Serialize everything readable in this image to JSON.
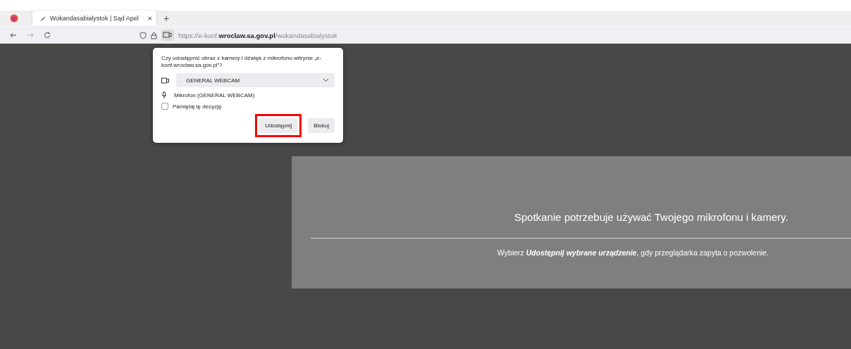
{
  "tabs": [
    {
      "title": "Wokandasabialystok | Sąd Apel",
      "selected": true,
      "close": "×"
    }
  ],
  "new_tab": "+",
  "address_bar": {
    "url": "https://e-konf.**wroclaw.sa.gov.pl**/wokandasabialystok"
  },
  "permission_popup": {
    "question": "Czy udostępnić obraz z kamery i dźwięk z mikrofonu witrynie „e-konf.wroclaw.sa.gov.pl”?",
    "camera": "GENERAL WEBCAM",
    "microphone": "Mikrofon (GENERAL WEBCAM)",
    "remember": {
      "label": "Pamiętaj tę decyzję",
      "checked": false
    },
    "buttons": [
      {
        "label": "Udostępnij",
        "highlighted": true
      },
      {
        "label": "Blokuj",
        "highlighted": false
      }
    ]
  },
  "notice": {
    "title": "Spotkanie potrzebuje używać Twojego mikrofonu i kamery.",
    "hint": "Wybierz **Udostępnij wybrane urządzenie**, gdy przeglądarka zapyta o pozwolenie."
  }
}
